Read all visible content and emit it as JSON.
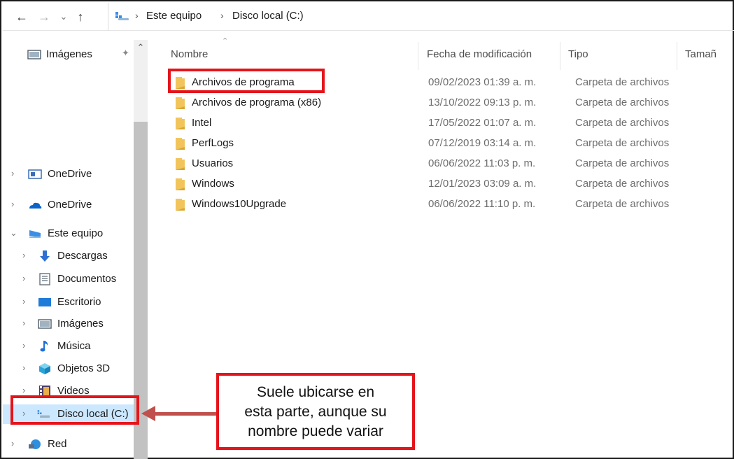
{
  "address_bar": {
    "back_icon": "back-arrow-icon",
    "forward_icon": "forward-arrow-icon",
    "recent_icon": "chevron-down-icon",
    "up_icon": "up-arrow-icon",
    "breadcrumbs": [
      "Este equipo",
      "Disco local (C:)"
    ]
  },
  "sidebar": {
    "items": [
      {
        "label": "Imágenes",
        "icon": "pictures-icon",
        "expander": "",
        "pinned": true
      },
      {
        "label": "OneDrive",
        "icon": "onedrive-business-icon",
        "expander": ">"
      },
      {
        "label": "OneDrive",
        "icon": "onedrive-cloud-icon",
        "expander": ">"
      },
      {
        "label": "Este equipo",
        "icon": "this-pc-icon",
        "expander": "v"
      },
      {
        "label": "Descargas",
        "icon": "downloads-icon",
        "expander": ">"
      },
      {
        "label": "Documentos",
        "icon": "documents-icon",
        "expander": ">"
      },
      {
        "label": "Escritorio",
        "icon": "desktop-icon",
        "expander": ">"
      },
      {
        "label": "Imágenes",
        "icon": "pictures-icon",
        "expander": ">"
      },
      {
        "label": "Música",
        "icon": "music-icon",
        "expander": ">"
      },
      {
        "label": "Objetos 3D",
        "icon": "3d-objects-icon",
        "expander": ">"
      },
      {
        "label": "Videos",
        "icon": "videos-icon",
        "expander": ">"
      },
      {
        "label": "Disco local (C:)",
        "icon": "local-disk-icon",
        "expander": ">",
        "selected": true
      },
      {
        "label": "Red",
        "icon": "network-icon",
        "expander": ">"
      }
    ]
  },
  "columns": {
    "name": "Nombre",
    "date": "Fecha de modificación",
    "type": "Tipo",
    "size": "Tamañ"
  },
  "files": [
    {
      "name": "Archivos de programa",
      "date": "09/02/2023 01:39 a. m.",
      "type": "Carpeta de archivos"
    },
    {
      "name": "Archivos de programa (x86)",
      "date": "13/10/2022 09:13 p. m.",
      "type": "Carpeta de archivos"
    },
    {
      "name": "Intel",
      "date": "17/05/2022 01:07 a. m.",
      "type": "Carpeta de archivos"
    },
    {
      "name": "PerfLogs",
      "date": "07/12/2019 03:14 a. m.",
      "type": "Carpeta de archivos"
    },
    {
      "name": "Usuarios",
      "date": "06/06/2022 11:03 p. m.",
      "type": "Carpeta de archivos"
    },
    {
      "name": "Windows",
      "date": "12/01/2023 03:09 a. m.",
      "type": "Carpeta de archivos"
    },
    {
      "name": "Windows10Upgrade",
      "date": "06/06/2022 11:10 p. m.",
      "type": "Carpeta de archivos"
    }
  ],
  "annotation": {
    "callout_lines": [
      "Suele ubicarse en",
      "esta parte, aunque su",
      "nombre puede variar"
    ],
    "color": "#e5141b",
    "arrow_color": "#c0504d"
  },
  "colors": {
    "folder": "#f2c55c",
    "selection": "#cce8ff"
  }
}
